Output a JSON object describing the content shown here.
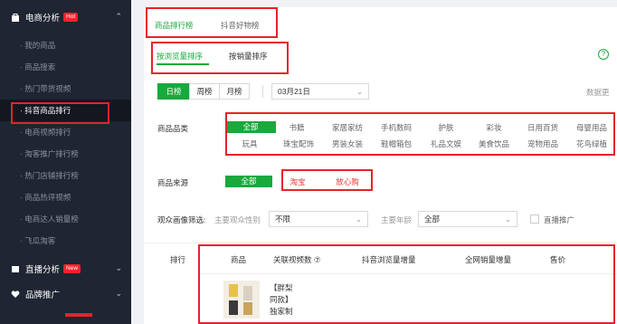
{
  "sidebar": {
    "group1": {
      "label": "电商分析",
      "badge": "Hot"
    },
    "items": [
      "· 我的商品",
      "· 商品搜索",
      "· 热门带货视频",
      "· 抖音商品排行",
      "· 电商视频排行",
      "· 淘客推广排行榜",
      "· 热门店铺排行榜",
      "· 商品热评视频",
      "· 电商达人销量榜",
      "· 飞瓜淘客"
    ],
    "group2": {
      "label": "直播分析",
      "badge": "New"
    },
    "group3": {
      "label": "品牌推广"
    }
  },
  "tabs": {
    "t1": "商品排行榜",
    "t2": "抖音好物榜"
  },
  "subtabs": {
    "s1": "按浏览量排序",
    "s2": "按销量排序"
  },
  "help": "?",
  "period": {
    "day": "日榜",
    "week": "周榜",
    "month": "月榜"
  },
  "date": "03月21日",
  "data_update": "数据更",
  "category": {
    "label": "商品品类",
    "row1": [
      "全部",
      "书籍",
      "家居家纺",
      "手机数码",
      "护肤",
      "彩妆",
      "日用百货",
      "母婴用品"
    ],
    "row2": [
      "玩具",
      "珠宝配饰",
      "男装女装",
      "鞋帽箱包",
      "礼品文娱",
      "美食饮品",
      "宠物用品",
      "花鸟绿植"
    ]
  },
  "source": {
    "label": "商品来源",
    "all": "全部",
    "taobao": "淘宝",
    "fangxingou": "放心购"
  },
  "audience": {
    "label": "观众画像筛选:",
    "gender_label": "主要观众性别",
    "gender_value": "不限",
    "age_label": "主要年龄",
    "age_value": "全部",
    "live_label": "直播推广"
  },
  "table": {
    "headers": [
      "排行",
      "商品",
      "关联视频数 ⑦",
      "抖音浏览量增量",
      "全网销量增量",
      "售价"
    ],
    "row1_title": [
      "【胖梨",
      "同款】",
      "独家制"
    ]
  },
  "colors": {
    "accent": "#19a93d",
    "highlight": "#e5232b",
    "sidebar": "#1f2532"
  }
}
